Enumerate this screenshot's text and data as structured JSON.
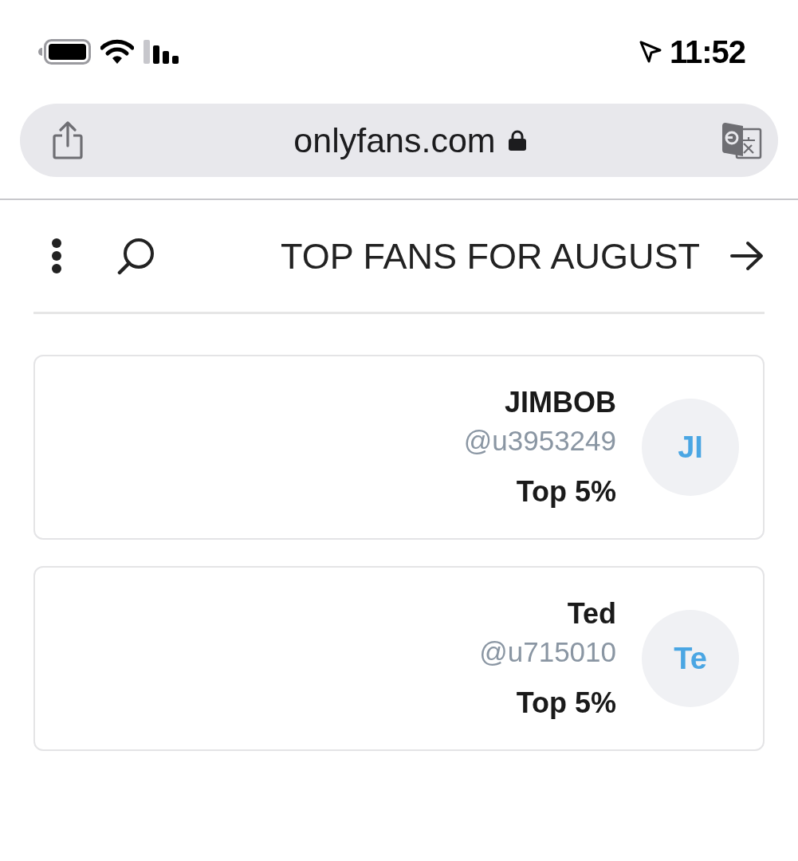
{
  "status_bar": {
    "time": "11:52"
  },
  "address_bar": {
    "url": "onlyfans.com",
    "secure": true
  },
  "header": {
    "title": "TOP FANS FOR AUGUST"
  },
  "fans": [
    {
      "initials": "JI",
      "name": "JIMBOB",
      "handle": "@u3953249",
      "rank": "Top 5%"
    },
    {
      "initials": "Te",
      "name": "Ted",
      "handle": "@u715010",
      "rank": "Top 5%"
    }
  ]
}
